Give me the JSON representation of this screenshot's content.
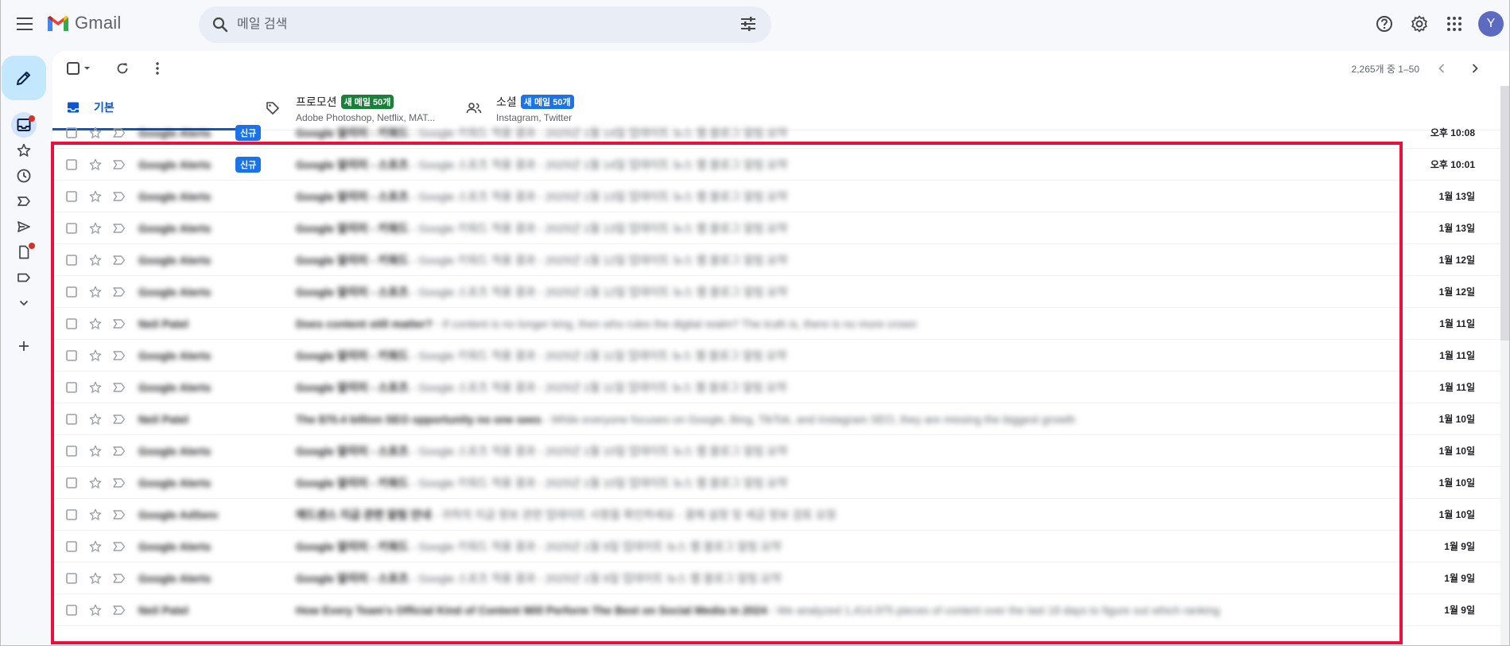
{
  "app": {
    "logo_text": "Gmail",
    "search_placeholder": "메일 검색",
    "avatar_letter": "Y"
  },
  "colors": {
    "accent": "#0b57d0",
    "compose_bg": "#c2e7ff",
    "highlight_border": "#e8103c",
    "badge_green": "#188038",
    "badge_blue": "#1a73e8"
  },
  "toolbar": {
    "pager_text": "2,265개 중 1–50"
  },
  "tabs": [
    {
      "label": "기본",
      "sub": "",
      "badge": ""
    },
    {
      "label": "프로모션",
      "sub": "Adobe Photoshop, Netflix, MAT...",
      "badge": "새 메일 50개"
    },
    {
      "label": "소셜",
      "sub": "Instagram, Twitter",
      "badge": "새 메일 50개"
    }
  ],
  "emails": [
    {
      "sender": "Google Alerts",
      "badge": "신규",
      "subject": "Google 알리미 - 키워드",
      "snippet": "Google 키워드 적용 결과 - 2025년 1월 14일 업데이트 뉴스 웹 블로그 알림 요약",
      "date": "오후 10:08"
    },
    {
      "sender": "Google Alerts",
      "badge": "신규",
      "subject": "Google 알리미 - 스포츠",
      "snippet": "Google 스포츠 적용 결과 - 2025년 1월 14일 업데이트 뉴스 웹 블로그 알림 요약",
      "date": "오후 10:01"
    },
    {
      "sender": "Google Alerts",
      "badge": "",
      "subject": "Google 알리미 - 스포츠",
      "snippet": "Google 스포츠 적용 결과 - 2025년 1월 13일 업데이트 뉴스 웹 블로그 알림 요약",
      "date": "1월 13일"
    },
    {
      "sender": "Google Alerts",
      "badge": "",
      "subject": "Google 알리미 - 키워드",
      "snippet": "Google 키워드 적용 결과 - 2025년 1월 13일 업데이트 뉴스 웹 블로그 알림 요약",
      "date": "1월 13일"
    },
    {
      "sender": "Google Alerts",
      "badge": "",
      "subject": "Google 알리미 - 키워드",
      "snippet": "Google 키워드 적용 결과 - 2025년 1월 12일 업데이트 뉴스 웹 블로그 알림 요약",
      "date": "1월 12일"
    },
    {
      "sender": "Google Alerts",
      "badge": "",
      "subject": "Google 알리미 - 스포츠",
      "snippet": "Google 스포츠 적용 결과 - 2025년 1월 12일 업데이트 뉴스 웹 블로그 알림 요약",
      "date": "1월 12일"
    },
    {
      "sender": "Neil Patel",
      "badge": "",
      "subject": "Does content still matter?",
      "snippet": "If content is no longer king, then who rules the digital realm? The truth is, there is no more crown",
      "date": "1월 11일"
    },
    {
      "sender": "Google Alerts",
      "badge": "",
      "subject": "Google 알리미 - 키워드",
      "snippet": "Google 키워드 적용 결과 - 2025년 1월 11일 업데이트 뉴스 웹 블로그 알림 요약",
      "date": "1월 11일"
    },
    {
      "sender": "Google Alerts",
      "badge": "",
      "subject": "Google 알리미 - 스포츠",
      "snippet": "Google 스포츠 적용 결과 - 2025년 1월 11일 업데이트 뉴스 웹 블로그 알림 요약",
      "date": "1월 11일"
    },
    {
      "sender": "Neil Patel",
      "badge": "",
      "subject": "The $70.4 billion SEO opportunity no one sees",
      "snippet": "While everyone focuses on Google, Bing, TikTok, and Instagram SEO, they are missing the biggest growth",
      "date": "1월 10일"
    },
    {
      "sender": "Google Alerts",
      "badge": "",
      "subject": "Google 알리미 - 스포츠",
      "snippet": "Google 스포츠 적용 결과 - 2025년 1월 10일 업데이트 뉴스 웹 블로그 알림 요약",
      "date": "1월 10일"
    },
    {
      "sender": "Google Alerts",
      "badge": "",
      "subject": "Google 알리미 - 키워드",
      "snippet": "Google 키워드 적용 결과 - 2025년 1월 10일 업데이트 뉴스 웹 블로그 알림 요약",
      "date": "1월 10일"
    },
    {
      "sender": "Google AdSense",
      "badge": "",
      "subject": "애드센스 지급 관련 알림 안내",
      "snippet": "귀하의 지급 정보 관련 업데이트 사항을 확인하세요 - 결제 설정 및 세금 정보 검토 요청",
      "date": "1월 10일"
    },
    {
      "sender": "Google Alerts",
      "badge": "",
      "subject": "Google 알리미 - 키워드",
      "snippet": "Google 키워드 적용 결과 - 2025년 1월 9일 업데이트 뉴스 웹 블로그 알림 요약",
      "date": "1월 9일"
    },
    {
      "sender": "Google Alerts",
      "badge": "",
      "subject": "Google 알리미 - 스포츠",
      "snippet": "Google 스포츠 적용 결과 - 2025년 1월 9일 업데이트 뉴스 웹 블로그 알림 요약",
      "date": "1월 9일"
    },
    {
      "sender": "Neil Patel",
      "badge": "",
      "subject": "How Every Team's Official Kind of Content Will Perform The Best on Social Media in 2024",
      "snippet": "We analyzed 1,414,975 pieces of content over the last 18 days to figure out which ranking",
      "date": "1월 9일"
    }
  ]
}
